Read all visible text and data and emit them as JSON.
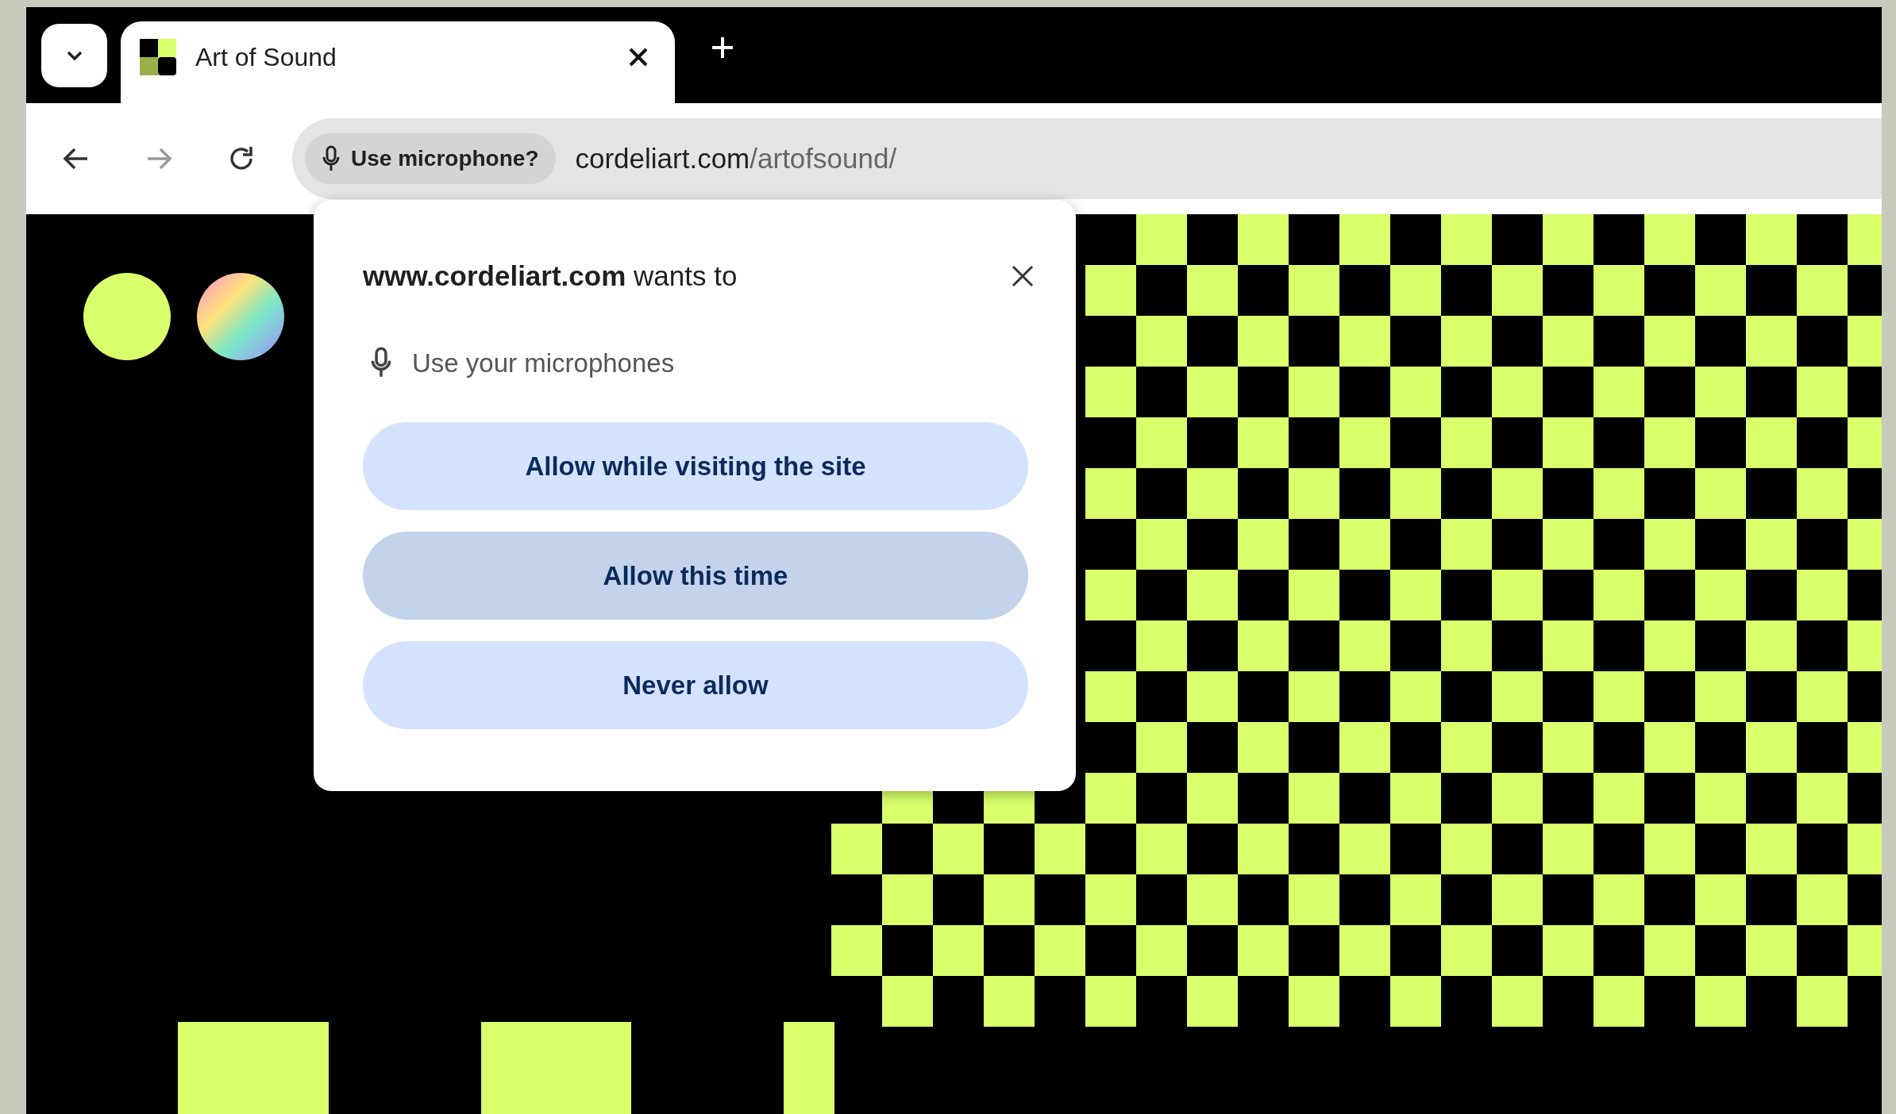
{
  "tabs": [
    {
      "title": "Art of Sound",
      "selected": true
    }
  ],
  "nav_buttons": [
    {
      "kind": "back",
      "disabled": false
    },
    {
      "kind": "forward",
      "disabled": true
    },
    {
      "kind": "reload",
      "disabled": false
    }
  ],
  "address_bar": {
    "chip": "Use microphone?",
    "url_host": "cordeliart.com",
    "url_path": "/artofsound/"
  },
  "permission_popup": {
    "title": "**www.cordeliart.com** wants to",
    "permission": "Use your microphones",
    "buttons": [
      {
        "label": "Allow while visiting the site",
        "hovered": false
      },
      {
        "label": "Allow this time",
        "hovered": true
      },
      {
        "label": "Never allow",
        "hovered": false
      }
    ]
  }
}
